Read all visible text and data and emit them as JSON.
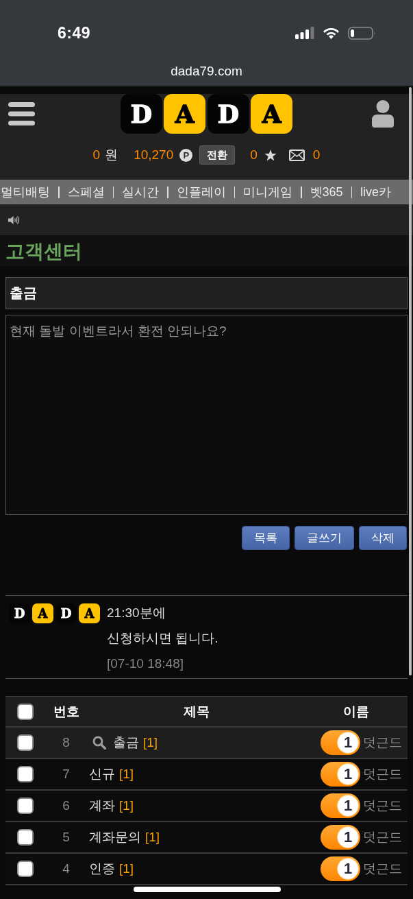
{
  "status_bar": {
    "time": "6:49"
  },
  "address_bar": {
    "url": "dada79.com"
  },
  "header": {
    "logo": [
      {
        "letter": "D",
        "kind": "dark"
      },
      {
        "letter": "A",
        "kind": "yellow"
      },
      {
        "letter": "D",
        "kind": "dark"
      },
      {
        "letter": "A",
        "kind": "yellow"
      }
    ],
    "balance": {
      "amount": "0",
      "unit": "원"
    },
    "points": {
      "amount": "10,270",
      "badge": "P"
    },
    "convert_button": "전환",
    "favorites_count": "0",
    "messages_count": "0"
  },
  "nav": {
    "items": [
      "멀티배팅",
      "스페셜",
      "실시간",
      "인플레이",
      "미니게임",
      "벳365",
      "live카"
    ]
  },
  "page_title": "고객센터",
  "post": {
    "subject": "출금",
    "body": "현재 돌발 이벤트라서 환전 안되나요?",
    "buttons": [
      "목록",
      "글쓰기",
      "삭제"
    ]
  },
  "comment": {
    "author_logo": [
      {
        "letter": "D",
        "kind": "dark"
      },
      {
        "letter": "A",
        "kind": "yellow"
      },
      {
        "letter": "D",
        "kind": "dark"
      },
      {
        "letter": "A",
        "kind": "yellow"
      }
    ],
    "lines": [
      "21:30분에",
      "신청하시면 됩니다."
    ],
    "date": "[07-10 18:48]"
  },
  "table": {
    "select_all": {
      "checked": false
    },
    "columns": [
      "번호",
      "제목",
      "이름"
    ],
    "rows": [
      {
        "checked": false,
        "selected": true,
        "number": "8",
        "title": "출금",
        "comments": "[1]",
        "level_badge": "1",
        "name": "덧근드"
      },
      {
        "checked": false,
        "selected": false,
        "number": "7",
        "title": "신규",
        "comments": "[1]",
        "level_badge": "1",
        "name": "덧근드"
      },
      {
        "checked": false,
        "selected": false,
        "number": "6",
        "title": "계좌",
        "comments": "[1]",
        "level_badge": "1",
        "name": "덧근드"
      },
      {
        "checked": false,
        "selected": false,
        "number": "5",
        "title": "계좌문의",
        "comments": "[1]",
        "level_badge": "1",
        "name": "덧근드"
      },
      {
        "checked": false,
        "selected": false,
        "number": "4",
        "title": "인증",
        "comments": "[1]",
        "level_badge": "1",
        "name": "덧근드"
      }
    ]
  }
}
